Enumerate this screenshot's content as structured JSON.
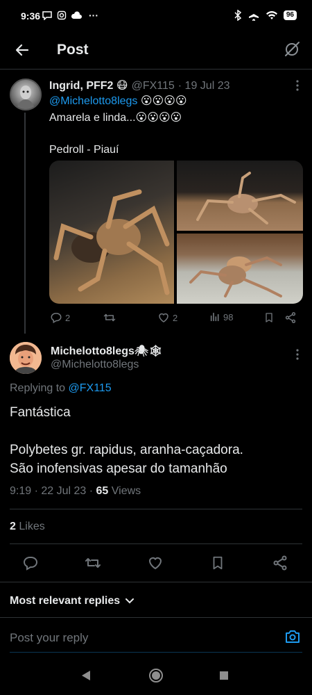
{
  "status_bar": {
    "time": "9:36",
    "battery": "96"
  },
  "header": {
    "title": "Post"
  },
  "parent_tweet": {
    "display_name": "Ingrid, PFF2 😷",
    "handle": "@FX115",
    "date": "· 19 Jul 23",
    "mention": "@Michelotto8legs",
    "emojis_line1": "😮😮😮😮",
    "line2": "Amarela e linda...😮😮😮😮",
    "line3": "Pedroll - Piauí",
    "replies": "2",
    "likes": "2",
    "views": "98"
  },
  "main_tweet": {
    "display_name": "Michelotto8legs🕷🕸",
    "handle": "@Michelotto8legs",
    "replying_prefix": "Replying to",
    "replying_to": "@FX115",
    "text_line1": "Fantástica",
    "text_line2": "Polybetes gr. rapidus, aranha-caçadora.",
    "text_line3": "São inofensivas apesar do tamanhão",
    "time_date": "9:19 · 22 Jul 23 ·",
    "views_count": "65",
    "views_label": "Views",
    "likes_count": "2",
    "likes_label": "Likes"
  },
  "replies_filter": {
    "label": "Most relevant replies"
  },
  "reply_box": {
    "placeholder": "Post your reply"
  },
  "colors": {
    "accent": "#1d9bf0",
    "muted": "#71767b",
    "divider": "#2f3336",
    "background": "#000000"
  }
}
